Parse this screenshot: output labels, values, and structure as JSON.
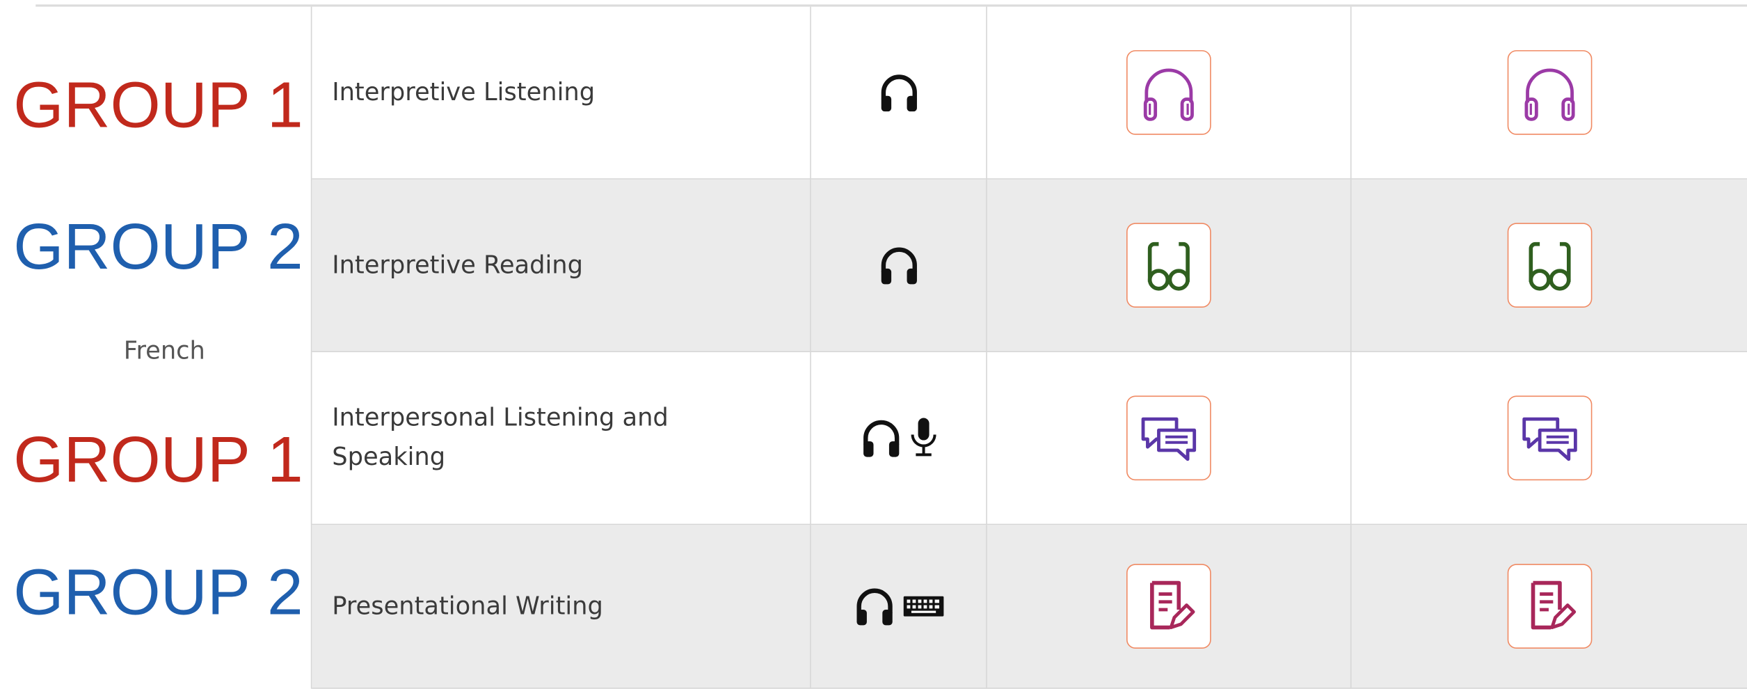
{
  "language": "French",
  "group_labels": [
    {
      "text": "GROUP 1",
      "color": "#c1291c"
    },
    {
      "text": "GROUP 2",
      "color": "#1f5fae"
    },
    {
      "text": "GROUP 1",
      "color": "#c1291c"
    },
    {
      "text": "GROUP 2",
      "color": "#1f5fae"
    }
  ],
  "rows": [
    {
      "name": "Interpretive Listening",
      "tools": [
        "headphones-icon"
      ],
      "skill_icon": "headphones-skill-icon",
      "skill_color": "#9b3aa6"
    },
    {
      "name": "Interpretive Reading",
      "tools": [
        "headphones-icon"
      ],
      "skill_icon": "glasses-skill-icon",
      "skill_color": "#2f5f1f"
    },
    {
      "name": "Interpersonal Listening and Speaking",
      "tools": [
        "headphones-icon",
        "microphone-icon"
      ],
      "skill_icon": "chat-bubbles-skill-icon",
      "skill_color": "#5a36a8"
    },
    {
      "name": "Presentational Writing",
      "tools": [
        "headphones-icon",
        "keyboard-icon"
      ],
      "skill_icon": "edit-document-skill-icon",
      "skill_color": "#a8275a"
    }
  ],
  "colors": {
    "skill_border": "#f08a63",
    "grid_line": "#d6d6d6",
    "shaded_row": "#ebebeb"
  }
}
